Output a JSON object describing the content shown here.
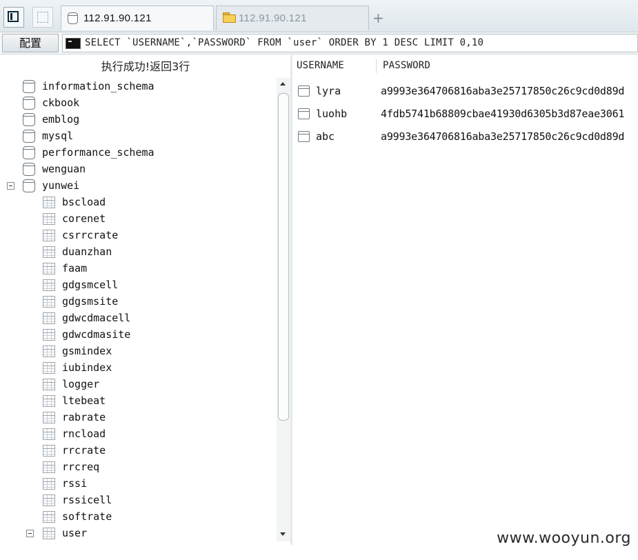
{
  "tabs": [
    {
      "label": "112.91.90.121",
      "active": true,
      "icon": "database-icon"
    },
    {
      "label": "112.91.90.121",
      "active": false,
      "icon": "folder-icon"
    }
  ],
  "toolbar": {
    "config_label": "配置"
  },
  "sql": {
    "query": "SELECT `USERNAME`,`PASSWORD` FROM `user` ORDER BY 1 DESC LIMIT 0,10"
  },
  "status": {
    "message": "执行成功!返回3行"
  },
  "tree": {
    "databases": [
      "information_schema",
      "ckbook",
      "emblog",
      "mysql",
      "performance_schema",
      "wenguan",
      "yunwei"
    ],
    "expanded_db": "yunwei",
    "tables": [
      "bscload",
      "corenet",
      "csrrcrate",
      "duanzhan",
      "faam",
      "gdgsmcell",
      "gdgsmsite",
      "gdwcdmacell",
      "gdwcdmasite",
      "gsmindex",
      "iubindex",
      "logger",
      "ltebeat",
      "rabrate",
      "rncload",
      "rrcrate",
      "rrcreq",
      "rssi",
      "rssicell",
      "softrate",
      "user"
    ]
  },
  "results": {
    "columns": [
      "USERNAME",
      "PASSWORD"
    ],
    "rows": [
      {
        "username": "lyra",
        "password": "a9993e364706816aba3e25717850c26c9cd0d89d"
      },
      {
        "username": "luohb",
        "password": "4fdb5741b68809cbae41930d6305b3d87eae3061"
      },
      {
        "username": "abc",
        "password": "a9993e364706816aba3e25717850c26c9cd0d89d"
      }
    ]
  },
  "watermark": "www.wooyun.org"
}
